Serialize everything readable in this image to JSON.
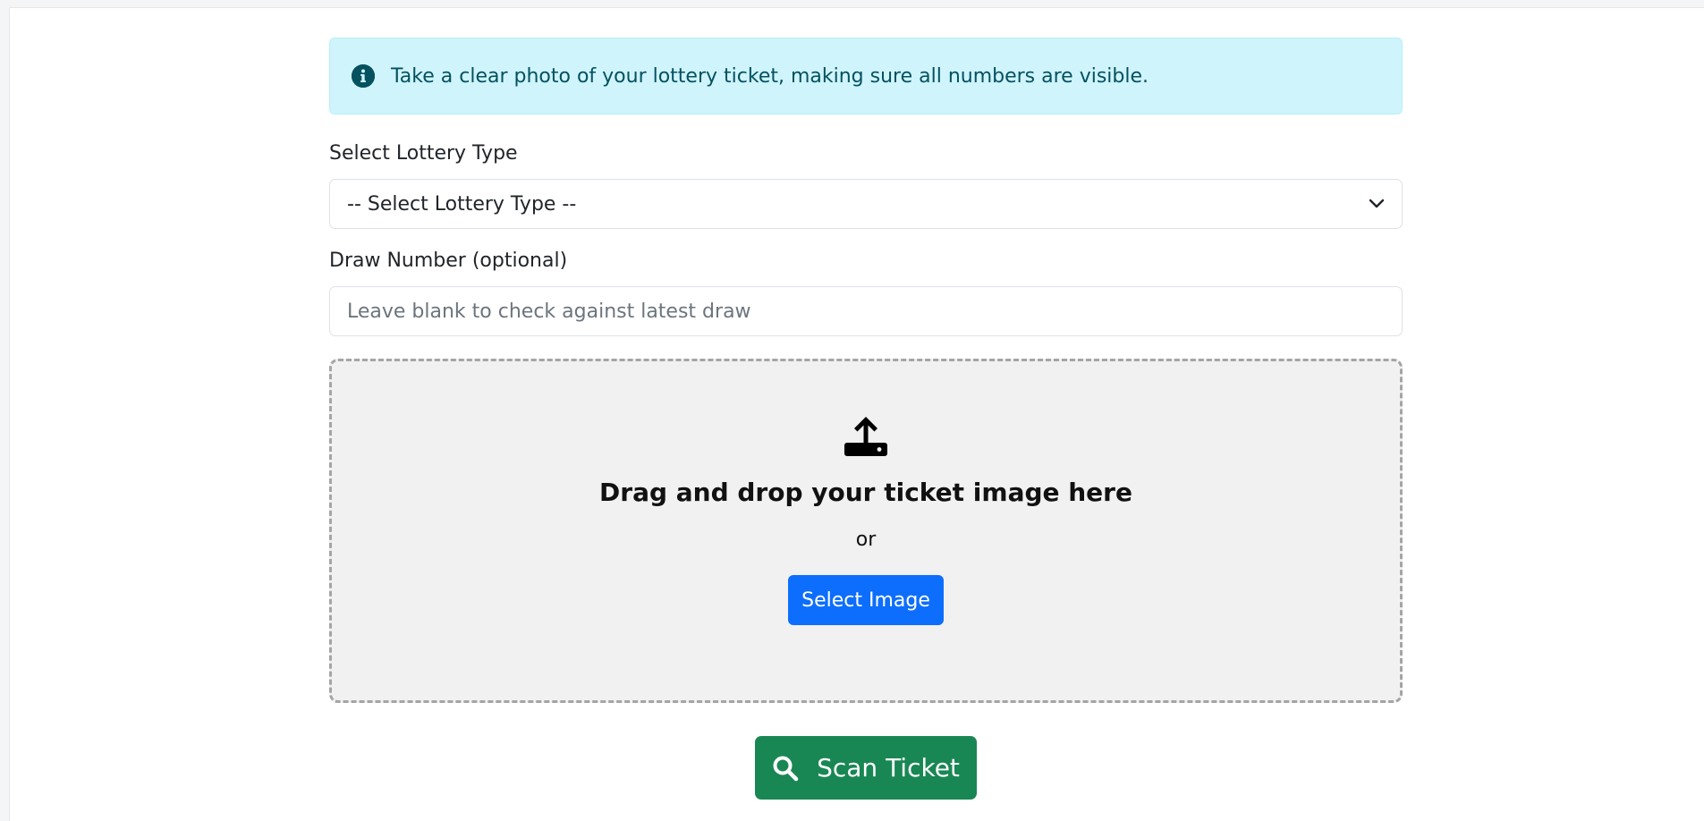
{
  "alert": {
    "icon": "info-circle-icon",
    "text": "Take a clear photo of your lottery ticket, making sure all numbers are visible."
  },
  "lottery_type": {
    "label": "Select Lottery Type",
    "selected": "-- Select Lottery Type --",
    "icon": "chevron-down-icon"
  },
  "draw_number": {
    "label": "Draw Number (optional)",
    "placeholder": "Leave blank to check against latest draw",
    "value": ""
  },
  "dropzone": {
    "icon": "upload-icon",
    "title": "Drag and drop your ticket image here",
    "or_text": "or",
    "select_button": "Select Image"
  },
  "scan_button": {
    "icon": "search-icon",
    "label": "Scan Ticket"
  },
  "colors": {
    "info_bg": "#cff4fc",
    "info_text": "#055160",
    "primary": "#0d6efd",
    "success": "#198754",
    "dropzone_bg": "#f1f1f1"
  }
}
